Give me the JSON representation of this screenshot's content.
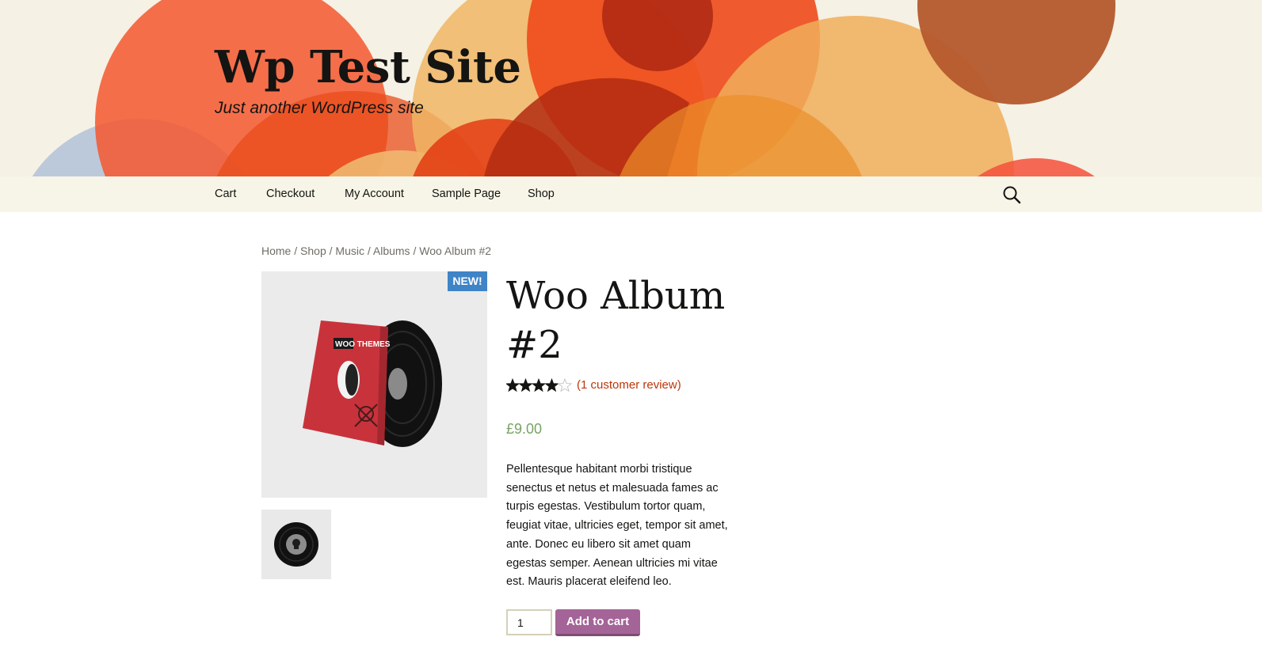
{
  "site": {
    "title": "Wp Test Site",
    "tagline": "Just another WordPress site"
  },
  "nav": {
    "items": [
      {
        "label": "Cart"
      },
      {
        "label": "Checkout"
      },
      {
        "label": "My Account"
      },
      {
        "label": "Sample Page"
      },
      {
        "label": "Shop"
      }
    ],
    "search_icon": "search-icon"
  },
  "breadcrumb": {
    "items": [
      "Home",
      "Shop",
      "Music",
      "Albums",
      "Woo Album #2"
    ],
    "separator": "/"
  },
  "product": {
    "badge": "NEW!",
    "title": "Woo Album #2",
    "rating": 4,
    "rating_max": 5,
    "review_link": "(1 customer review)",
    "price": "£9.00",
    "description": "Pellentesque habitant morbi tristique senectus et netus et malesuada fames ac turpis egestas. Vestibulum tortor quam, feugiat vitae, ultricies eget, tempor sit amet, ante. Donec eu libero sit amet quam egestas semper. Aenean ultricies mi vitae est. Mauris placerat eleifend leo.",
    "image_logo": "WOO THEMES",
    "quantity": "1",
    "add_to_cart": "Add to cart"
  },
  "colors": {
    "header_bg": "#f5f1e4",
    "nav_bg": "#f7f5e7",
    "badge": "#3f84c6",
    "price": "#77a464",
    "link": "#bc360a",
    "button": "#a46497"
  }
}
